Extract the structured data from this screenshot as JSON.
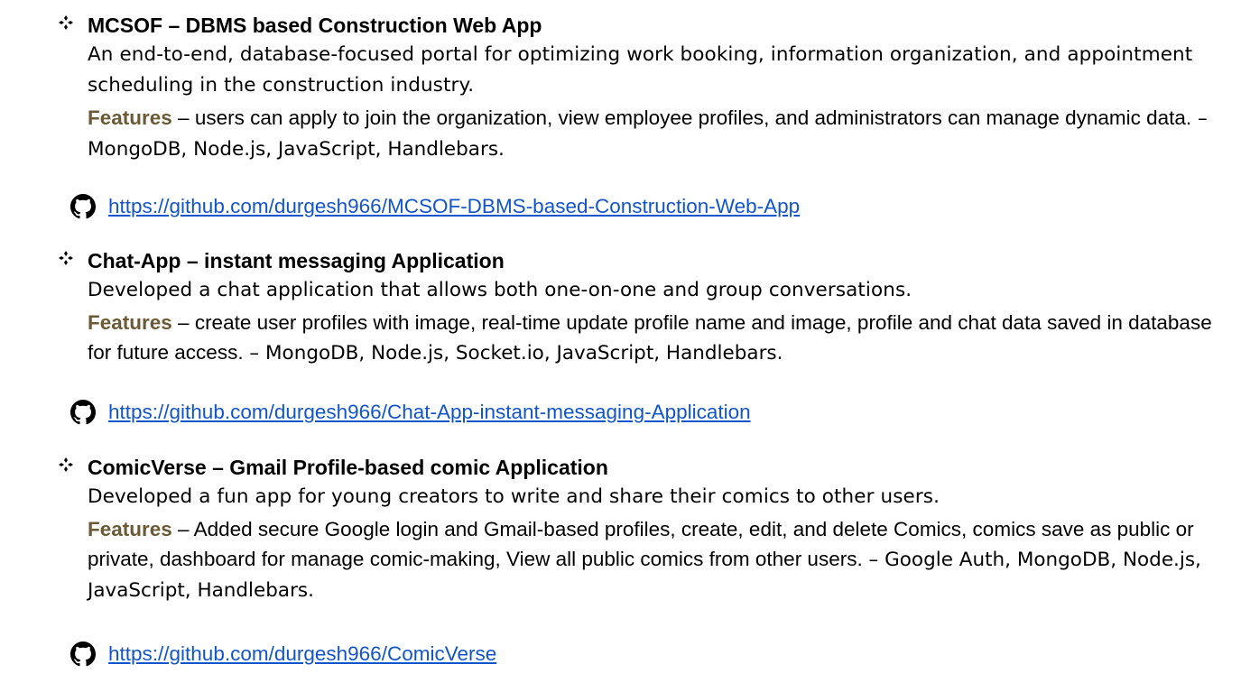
{
  "projects": [
    {
      "title": "MCSOF – DBMS based Construction Web App",
      "description": "An end-to-end, database-focused portal for optimizing work booking, information organization, and appointment scheduling in the construction industry.",
      "features_label": "Features",
      "features_text": " – users can apply to join the organization, view employee profiles, and administrators can manage dynamic data.",
      "tech": " – MongoDB, Node.js, JavaScript, Handlebars.",
      "link": "https://github.com/durgesh966/MCSOF-DBMS-based-Construction-Web-App",
      "icon": "github-icon"
    },
    {
      "title": "Chat-App – instant messaging Application",
      "description": "Developed a chat application that allows both one-on-one and group conversations.",
      "features_label": "Features",
      "features_text": " – create user profiles with image, real-time update profile name and image, profile and chat data saved in database for future access.",
      "tech": " – MongoDB, Node.js, Socket.io, JavaScript, Handlebars.",
      "link": "https://github.com/durgesh966/Chat-App-instant-messaging-Application",
      "icon": "github-icon"
    },
    {
      "title": "ComicVerse – Gmail Profile-based comic Application",
      "description": "Developed a fun app for young creators to write and share their comics to other users.",
      "features_label": "Features",
      "features_text": " – Added secure Google login and Gmail-based profiles, create, edit, and delete Comics, comics save as public or private, dashboard for manage comic-making, View all public comics from other users.",
      "tech": " – Google Auth, MongoDB, Node.js, JavaScript, Handlebars.",
      "link": "https://github.com/durgesh966/ComicVerse",
      "icon": "github-icon"
    }
  ],
  "colors": {
    "features_label": "#6b5a35",
    "link": "#1155cc",
    "text": "#000000"
  }
}
